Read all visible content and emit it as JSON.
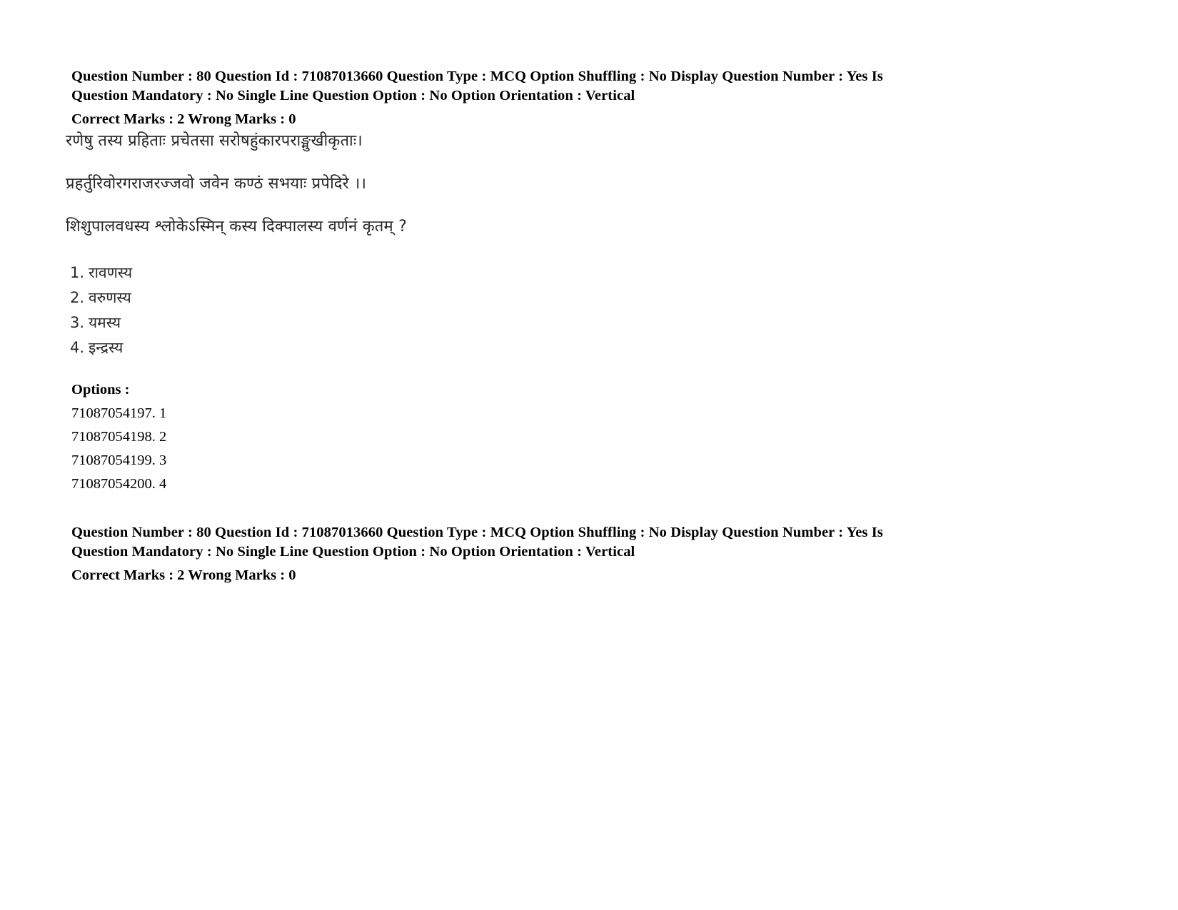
{
  "document": {
    "kind": "exam-question-sheet",
    "background_color": "#ffffff",
    "text_color": "#000000"
  },
  "header_top": {
    "line1": "Question Number : 80 Question Id : 71087013660 Question Type : MCQ Option Shuffling : No Display Question Number : Yes Is",
    "line2": "Question Mandatory : No Single Line Question Option : No Option Orientation : Vertical",
    "marks": "Correct Marks : 2 Wrong Marks : 0"
  },
  "passage": {
    "verse_line_1": "रणेषु तस्य प्रहिताः प्रचेतसा सरोषहुंकारपराङ्मुखीकृताः।",
    "verse_line_2": "प्रहर्तुरिवोरगराजरज्जवो जवेन कण्ठं सभयाः प्रपेदिरे ।।",
    "question_text": "शिशुपालवधस्य श्लोकेऽस्मिन् कस्य दिक्पालस्य वर्णनं कृतम् ?",
    "choices": [
      {
        "number": "1.",
        "text": "रावणस्य"
      },
      {
        "number": "2.",
        "text": "वरुणस्य"
      },
      {
        "number": "3.",
        "text": "यमस्य"
      },
      {
        "number": "4.",
        "text": "इन्द्रस्य"
      }
    ]
  },
  "options_section": {
    "heading": "Options :",
    "rows": [
      {
        "id": "71087054197.",
        "label": "1"
      },
      {
        "id": "71087054198.",
        "label": "2"
      },
      {
        "id": "71087054199.",
        "label": "3"
      },
      {
        "id": "71087054200.",
        "label": "4"
      }
    ]
  },
  "header_bottom": {
    "line1": "Question Number : 80 Question Id : 71087013660 Question Type : MCQ Option Shuffling : No Display Question Number : Yes Is",
    "line2": "Question Mandatory : No Single Line Question Option : No Option Orientation : Vertical",
    "marks": "Correct Marks : 2 Wrong Marks : 0"
  }
}
